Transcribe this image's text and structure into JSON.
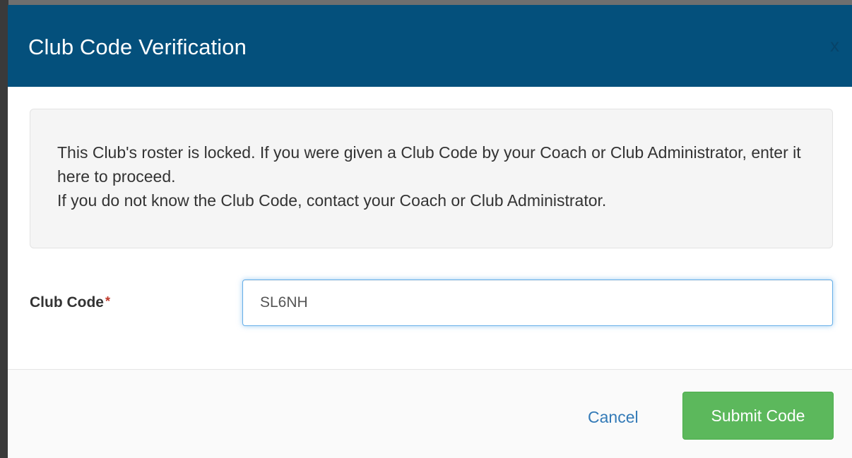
{
  "modal": {
    "title": "Club Code Verification",
    "close_label": "x"
  },
  "info": {
    "line1": "This Club's roster is locked. If you were given a Club Code by your Coach or Club Administrator, enter it here to proceed.",
    "line2": "If you do not know the Club Code, contact your Coach or Club Administrator."
  },
  "form": {
    "club_code_label": "Club Code",
    "required_marker": "*",
    "club_code_value": "SL6NH"
  },
  "footer": {
    "cancel_label": "Cancel",
    "submit_label": "Submit Code"
  },
  "colors": {
    "header_bg": "#04507c",
    "submit_bg": "#5cb85c",
    "link": "#337ab7",
    "required": "#c0392b"
  }
}
